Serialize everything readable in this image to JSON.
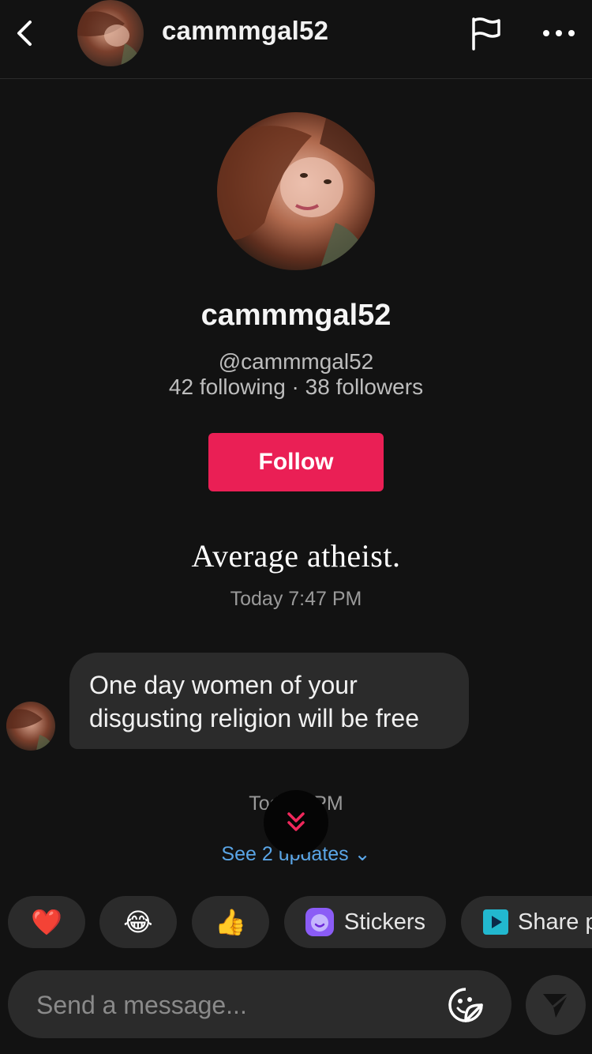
{
  "header": {
    "username": "cammmgal52"
  },
  "profile": {
    "display_name": "cammmgal52",
    "handle": "@cammmgal52",
    "stats": "42 following · 38 followers",
    "follow_label": "Follow"
  },
  "conversation": {
    "caption": "Average atheist.",
    "timestamp_1": "Today 7:47 PM",
    "message_text": "One day women of your disgusting religion will be free",
    "timestamp_2": "Toda   1 PM",
    "updates_label": "See 2 updates ⌄"
  },
  "quick_actions": {
    "heart": "❤️",
    "laugh": "😂",
    "thumbs": "👍",
    "stickers_label": "Stickers",
    "share_label": "Share p"
  },
  "composer": {
    "placeholder": "Send a message..."
  },
  "colors": {
    "background": "#121212",
    "accent_follow": "#ea1f55",
    "bubble": "#2b2b2b",
    "link": "#5aa5e6"
  },
  "icons": {
    "back": "chevron-left-icon",
    "flag": "flag-icon",
    "more": "more-horizontal-icon",
    "scroll": "double-chevron-down-icon",
    "emoji": "emoji-sticker-icon",
    "send": "send-icon"
  }
}
